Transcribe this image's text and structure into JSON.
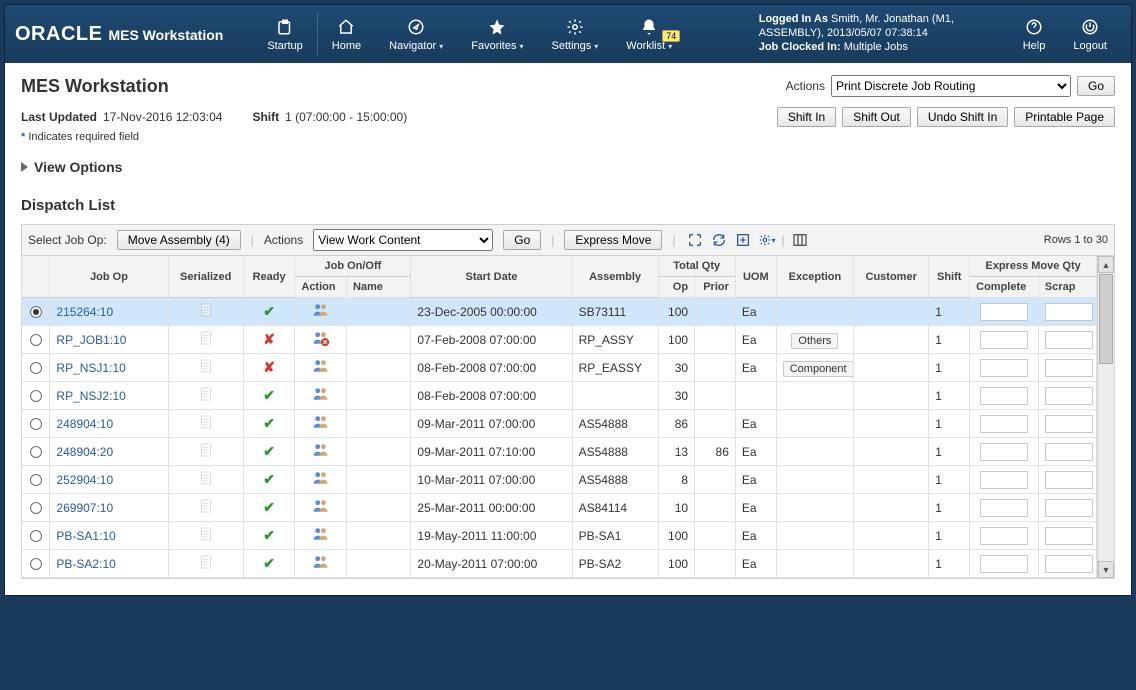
{
  "brand": {
    "logo": "ORACLE",
    "sub": "MES Workstation"
  },
  "nav": {
    "startup": "Startup",
    "home": "Home",
    "navigator": "Navigator",
    "favorites": "Favorites",
    "settings": "Settings",
    "worklist": "Worklist",
    "worklist_badge": "74",
    "help": "Help",
    "logout": "Logout"
  },
  "user": {
    "logged_in_as_label": "Logged In As",
    "name": "Smith, Mr. Jonathan (M1, ASSEMBLY), 2013/05/07 07:38:14",
    "clocked_label": "Job Clocked In:",
    "clocked_value": "Multiple Jobs"
  },
  "page": {
    "title": "MES Workstation",
    "actions_label": "Actions",
    "actions_selected": "Print Discrete Job Routing",
    "go": "Go",
    "last_updated_label": "Last Updated",
    "last_updated_value": "17-Nov-2016 12:03:04",
    "shift_label": "Shift",
    "shift_value": "1 (07:00:00 - 15:00:00)",
    "shift_in": "Shift In",
    "shift_out": "Shift Out",
    "undo_shift": "Undo Shift In",
    "printable": "Printable Page",
    "req_note_ast": "*",
    "req_note": "Indicates required field",
    "view_options": "View Options",
    "dispatch_title": "Dispatch List"
  },
  "toolbar": {
    "select_label": "Select Job Op:",
    "move_assembly": "Move Assembly (4)",
    "actions_label": "Actions",
    "action_selected": "View Work Content",
    "go": "Go",
    "express_move": "Express Move",
    "rows_info": "Rows 1 to 30"
  },
  "headers": {
    "job_op": "Job Op",
    "serialized": "Serialized",
    "ready": "Ready",
    "job_on_off": "Job On/Off",
    "action": "Action",
    "name": "Name",
    "start_date": "Start Date",
    "assembly": "Assembly",
    "total_qty": "Total Qty",
    "op": "Op",
    "prior": "Prior",
    "uom": "UOM",
    "exception": "Exception",
    "customer": "Customer",
    "shift": "Shift",
    "express_qty": "Express Move Qty",
    "complete": "Complete",
    "scrap": "Scrap"
  },
  "rows": [
    {
      "sel": true,
      "job": "215264:10",
      "ready": true,
      "action": "on",
      "start": "23-Dec-2005 00:00:00",
      "asm": "SB73111",
      "op": "100",
      "prior": "",
      "uom": "Ea",
      "exc": "",
      "shift": "1"
    },
    {
      "sel": false,
      "job": "RP_JOB1:10",
      "ready": false,
      "action": "off",
      "start": "07-Feb-2008 07:00:00",
      "asm": "RP_ASSY",
      "op": "100",
      "prior": "",
      "uom": "Ea",
      "exc": "Others",
      "shift": "1"
    },
    {
      "sel": false,
      "job": "RP_NSJ1:10",
      "ready": false,
      "action": "on",
      "start": "08-Feb-2008 07:00:00",
      "asm": "RP_EASSY",
      "op": "30",
      "prior": "",
      "uom": "Ea",
      "exc": "Component",
      "shift": "1"
    },
    {
      "sel": false,
      "job": "RP_NSJ2:10",
      "ready": true,
      "action": "on",
      "start": "08-Feb-2008 07:00:00",
      "asm": "",
      "op": "30",
      "prior": "",
      "uom": "",
      "exc": "",
      "shift": "1"
    },
    {
      "sel": false,
      "job": "248904:10",
      "ready": true,
      "action": "on",
      "start": "09-Mar-2011 07:00:00",
      "asm": "AS54888",
      "op": "86",
      "prior": "",
      "uom": "Ea",
      "exc": "",
      "shift": "1"
    },
    {
      "sel": false,
      "job": "248904:20",
      "ready": true,
      "action": "on",
      "start": "09-Mar-2011 07:10:00",
      "asm": "AS54888",
      "op": "13",
      "prior": "86",
      "uom": "Ea",
      "exc": "",
      "shift": "1"
    },
    {
      "sel": false,
      "job": "252904:10",
      "ready": true,
      "action": "on",
      "start": "10-Mar-2011 07:00:00",
      "asm": "AS54888",
      "op": "8",
      "prior": "",
      "uom": "Ea",
      "exc": "",
      "shift": "1"
    },
    {
      "sel": false,
      "job": "269907:10",
      "ready": true,
      "action": "on",
      "start": "25-Mar-2011 00:00:00",
      "asm": "AS84114",
      "op": "10",
      "prior": "",
      "uom": "Ea",
      "exc": "",
      "shift": "1"
    },
    {
      "sel": false,
      "job": "PB-SA1:10",
      "ready": true,
      "action": "on",
      "start": "19-May-2011 11:00:00",
      "asm": "PB-SA1",
      "op": "100",
      "prior": "",
      "uom": "Ea",
      "exc": "",
      "shift": "1"
    },
    {
      "sel": false,
      "job": "PB-SA2:10",
      "ready": true,
      "action": "on",
      "start": "20-May-2011 07:00:00",
      "asm": "PB-SA2",
      "op": "100",
      "prior": "",
      "uom": "Ea",
      "exc": "",
      "shift": "1"
    }
  ]
}
